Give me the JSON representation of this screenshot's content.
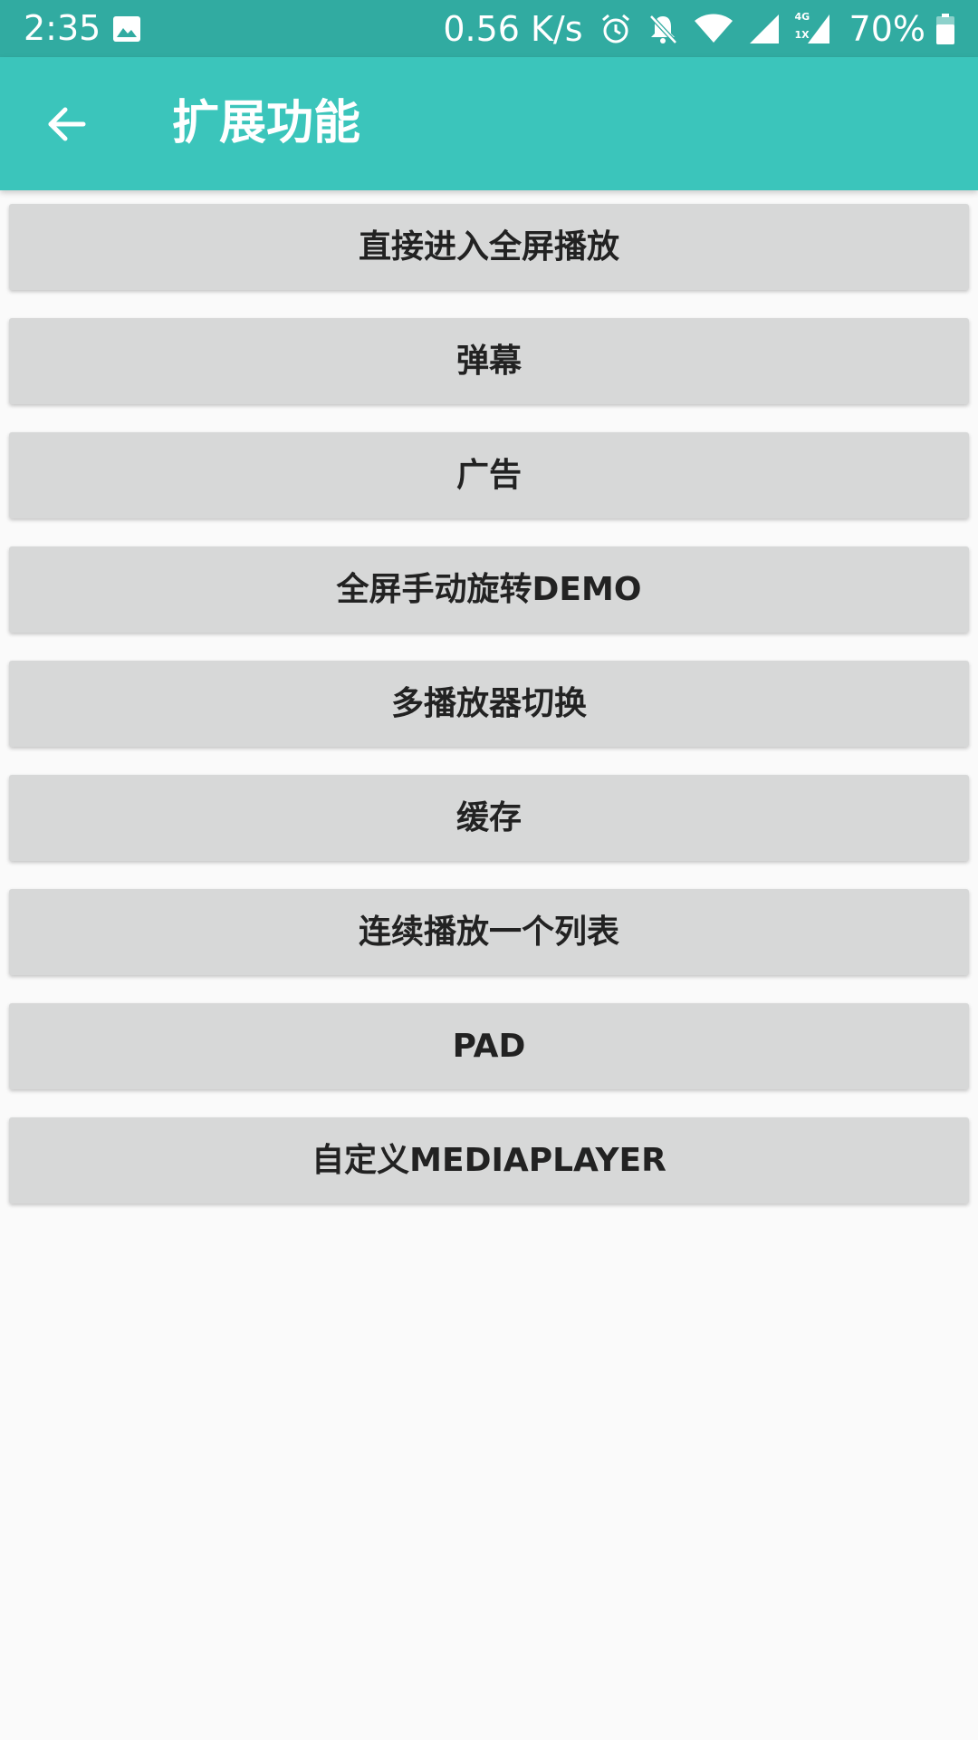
{
  "status_bar": {
    "time": "2:35",
    "network_speed": "0.56 K/s",
    "battery_percent": "70%",
    "icons": [
      "image-icon",
      "alarm-icon",
      "notifications-off-icon",
      "wifi-icon",
      "cell-signal-icon",
      "cell-signal-4g-icon",
      "battery-icon"
    ],
    "network_label_top": "4G",
    "network_label_bottom": "1X",
    "background_color": "#31aba1"
  },
  "app_bar": {
    "title": "扩展功能",
    "back_icon": "arrow-back-icon",
    "background_color": "#3bc5bb"
  },
  "buttons": [
    {
      "label": "直接进入全屏播放"
    },
    {
      "label": "弹幕"
    },
    {
      "label": "广告"
    },
    {
      "label": "全屏手动旋转DEMO"
    },
    {
      "label": "多播放器切换"
    },
    {
      "label": "缓存"
    },
    {
      "label": "连续播放一个列表"
    },
    {
      "label": "PAD"
    },
    {
      "label": "自定义MEDIAPLAYER"
    }
  ],
  "colors": {
    "button_background": "#d7d8d8",
    "button_text": "#222222",
    "page_background": "#fafafa"
  }
}
